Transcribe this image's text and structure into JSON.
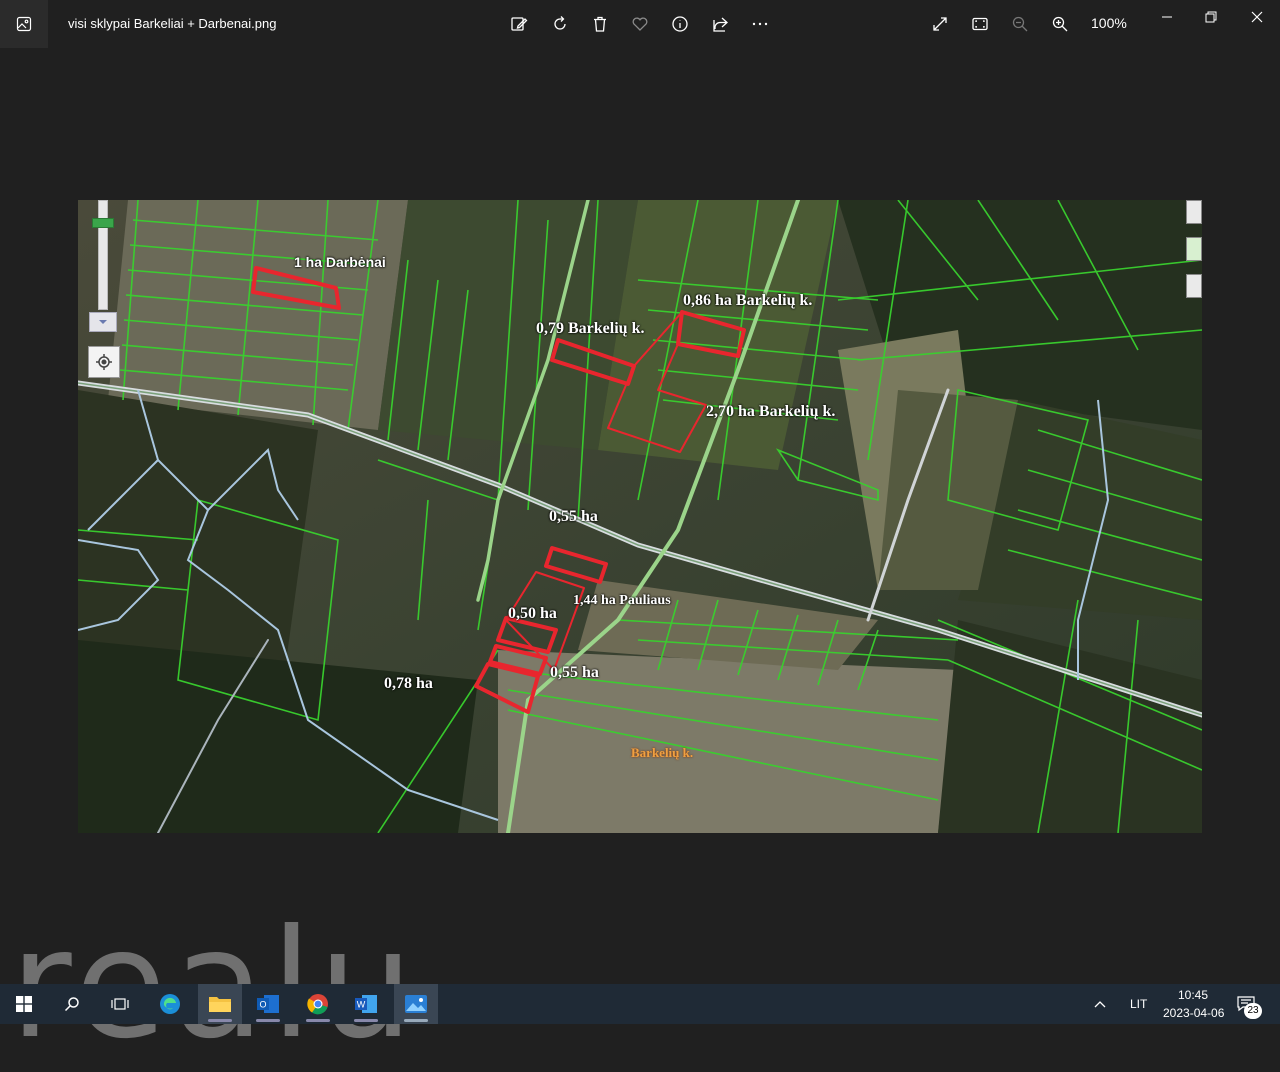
{
  "window": {
    "file_title": "visi sklypai Barkeliai + Darbenai.png",
    "zoom_level": "100%"
  },
  "toolbar": {
    "icons": [
      "edit-icon",
      "rotate-icon",
      "delete-icon",
      "favorite-icon",
      "info-icon",
      "share-icon",
      "more-icon"
    ],
    "right_icons": [
      "fullscreen-icon",
      "fit-icon",
      "zoom-out-icon",
      "zoom-in-icon"
    ]
  },
  "map": {
    "labels": {
      "darbenai": "1 ha Darbėnai",
      "p079": "0,79 Barkelių k.",
      "p086": "0,86 ha Barkelių k.",
      "p270": "2,70 ha Barkelių k.",
      "p055a": "0,55 ha",
      "p144": "1,44 ha Pauliaus",
      "p050": "0,50 ha",
      "p055b": "0,55 ha",
      "p078": "0,78 ha",
      "village": "Barkelių k."
    },
    "parcel_color": "#e8262e",
    "boundary_color": "#39d12e",
    "road_color": "#b9c4cf"
  },
  "watermark": "realu",
  "taskbar": {
    "apps": [
      "windows-start-icon",
      "search-icon",
      "task-view-icon",
      "edge-icon",
      "file-explorer-icon",
      "outlook-icon",
      "chrome-icon",
      "word-icon",
      "photos-icon"
    ],
    "language": "LIT",
    "time": "10:45",
    "date": "2023-04-06",
    "notifications": "23"
  }
}
